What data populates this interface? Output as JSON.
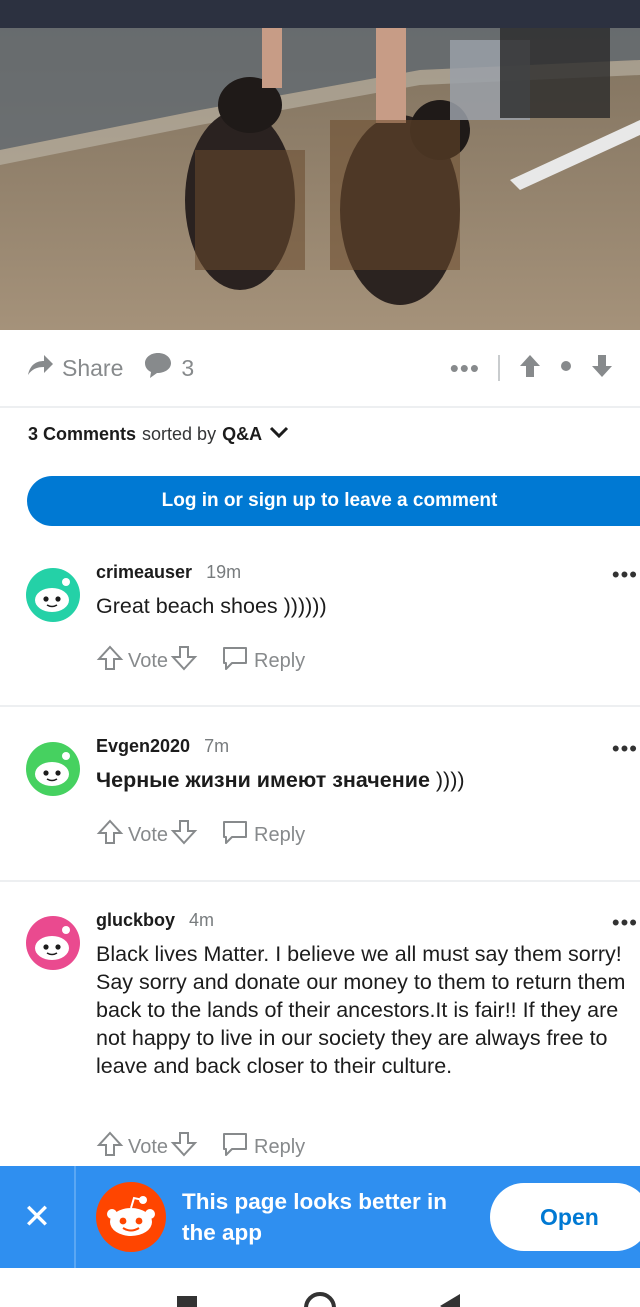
{
  "post": {
    "share_label": "Share",
    "comment_count": "3",
    "more_icon": "more-horizontal-icon"
  },
  "sort": {
    "count_label": "3 Comments",
    "sorted_by_label": "sorted by",
    "sort_value": "Q&A"
  },
  "login_button": "Log in or sign up to leave a comment",
  "comments": [
    {
      "author": "crimeauser",
      "time": "19m",
      "body": "Great beach shoes ))))))",
      "vote_label": "Vote",
      "reply_label": "Reply",
      "avatar_color": "#24d1a7"
    },
    {
      "author": "Evgen2020",
      "time": "7m",
      "body_bold": "Черные жизни имеют значение",
      "body_rest": " ))))",
      "vote_label": "Vote",
      "reply_label": "Reply",
      "avatar_color": "#46d160"
    },
    {
      "author": "gluckboy",
      "time": "4m",
      "body": "Black lives Matter. I believe we all must say them sorry! Say sorry and donate our money to them to return them back to the lands of their ancestors.It is fair!! If they are not happy to live in our society they are always free to leave and back closer to their culture.",
      "vote_label": "Vote",
      "reply_label": "Reply",
      "avatar_color": "#ea4a8f"
    }
  ],
  "app_banner": {
    "message": "This page looks better in the app",
    "open_label": "Open"
  },
  "colors": {
    "brand_blue": "#0079d3",
    "banner_blue": "#2f8ff0",
    "reddit_orange": "#ff4500"
  }
}
